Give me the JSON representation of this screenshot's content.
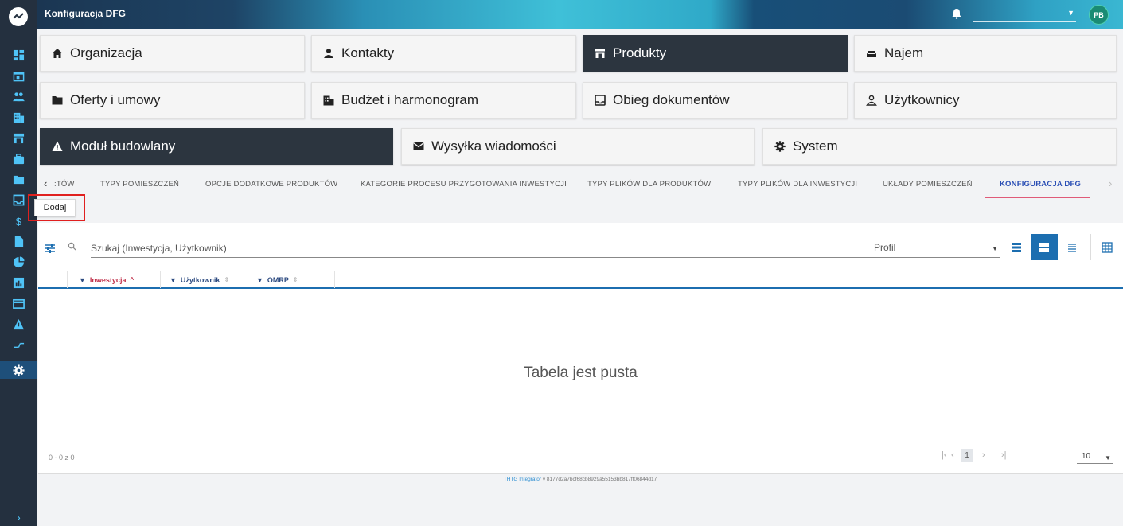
{
  "header": {
    "title": "Konfiguracja DFG",
    "user_initials": "PB",
    "user_select_value": ""
  },
  "sidebar": {
    "items": [
      {
        "icon": "dashboard-icon"
      },
      {
        "icon": "calendar-icon"
      },
      {
        "icon": "users-icon"
      },
      {
        "icon": "building-icon"
      },
      {
        "icon": "store-icon"
      },
      {
        "icon": "briefcase-icon"
      },
      {
        "icon": "folder-icon"
      },
      {
        "icon": "inbox-icon"
      },
      {
        "icon": "dollar-icon"
      },
      {
        "icon": "file-icon"
      },
      {
        "icon": "pie-chart-icon"
      },
      {
        "icon": "bar-chart-icon"
      },
      {
        "icon": "card-icon"
      },
      {
        "icon": "warning-icon"
      },
      {
        "icon": "transfer-icon"
      },
      {
        "icon": "gear-icon",
        "active": true
      }
    ],
    "expand_label": "›"
  },
  "modules": [
    {
      "label": "Organizacja",
      "icon": "home-icon"
    },
    {
      "label": "Kontakty",
      "icon": "person-icon"
    },
    {
      "label": "Produkty",
      "icon": "store-icon",
      "active": true
    },
    {
      "label": "Najem",
      "icon": "car-icon"
    },
    {
      "label": "Oferty i umowy",
      "icon": "folder-icon"
    },
    {
      "label": "Budżet i harmonogram",
      "icon": "building-icon"
    },
    {
      "label": "Obieg dokumentów",
      "icon": "inbox-icon"
    },
    {
      "label": "Użytkownicy",
      "icon": "user-outline-icon"
    },
    {
      "label": "Moduł budowlany",
      "icon": "warning-icon",
      "active": true
    },
    {
      "label": "Wysyłka wiadomości",
      "icon": "mail-icon"
    },
    {
      "label": "System",
      "icon": "gear-icon"
    }
  ],
  "tabs": [
    {
      "label": ":TÓW"
    },
    {
      "label": "TYPY POMIESZCZEŃ"
    },
    {
      "label": "OPCJE DODATKOWE PRODUKTÓW"
    },
    {
      "label": "KATEGORIE PROCESU PRZYGOTOWANIA INWESTYCJI"
    },
    {
      "label": "TYPY PLIKÓW DLA PRODUKTÓW"
    },
    {
      "label": "TYPY PLIKÓW DLA INWESTYCJI"
    },
    {
      "label": "UKŁADY POMIESZCZEŃ"
    },
    {
      "label": "KONFIGURACJA DFG",
      "active": true
    }
  ],
  "toolbar": {
    "add_label": "Dodaj"
  },
  "table": {
    "search_placeholder": "Szukaj (Inwestycja, Użytkownik)",
    "profile_placeholder": "Profil",
    "columns": [
      {
        "label": "Inwestycja",
        "sorted": "asc"
      },
      {
        "label": "Użytkownik"
      },
      {
        "label": "OMRP"
      }
    ],
    "empty_text": "Tabela jest pusta",
    "range_text": "0 - 0 z 0",
    "current_page": "1",
    "page_size": "10"
  },
  "footer": {
    "app_name": "THTG Integrator",
    "version": " v 8177d2a7bcf68cb8929a55153bb817ff06844d17"
  },
  "colors": {
    "sidebar_bg": "#24303f",
    "active_tile": "#2c353f",
    "accent_blue": "#1c6eb0",
    "sort_red": "#c0304a",
    "highlight_red": "#e0201f"
  }
}
